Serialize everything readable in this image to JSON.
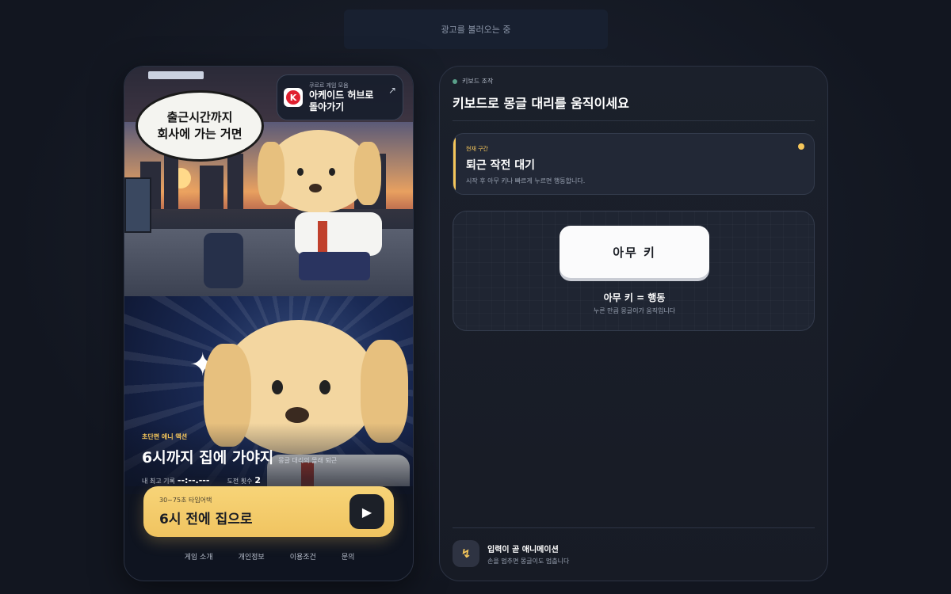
{
  "ad": {
    "text": "광고를 불러오는 중"
  },
  "scene": {
    "speech": [
      "출근시간까지",
      "회사에 가는 거면"
    ]
  },
  "hub": {
    "small": "쿠르르 게임 모음",
    "line1": "아케이드 허브로",
    "line2": "돌아가기",
    "logo": "K",
    "arrow_icon": "↗"
  },
  "game": {
    "tag": "초단편 애니 액션",
    "title": "6시까지 집에 가야지",
    "title_sub": "몽글 대리의 몰래 퇴근",
    "best_label": "내 최고 기록",
    "best_value": "--:--.---",
    "tries_label": "도전 횟수",
    "tries_value": "2"
  },
  "start": {
    "small": "30~75초 타임어택",
    "main": "6시 전에 집으로",
    "icon": "▶"
  },
  "footer": {
    "links": [
      "게임 소개",
      "개인정보",
      "이용조건",
      "문의"
    ]
  },
  "panel": {
    "tag": "키보드 조작",
    "title": "키보드로 몽글 대리를 움직이세요",
    "section": {
      "label": "현재 구간",
      "title": "퇴근 작전 대기",
      "desc": "시작 후 아무 키나 빠르게 누르면 행동합니다."
    },
    "key": {
      "label": "아무 키",
      "caption": "아무 키 = 행동",
      "sub": "누른 만큼 몽글이가 움직입니다"
    },
    "hint": {
      "icon": "↯",
      "title": "입력이 곧 애니메이션",
      "desc": "손을 멈추면 몽글이도 멈춥니다"
    }
  },
  "colors": {
    "accent": "#f5c65a",
    "bg": "#141924"
  }
}
